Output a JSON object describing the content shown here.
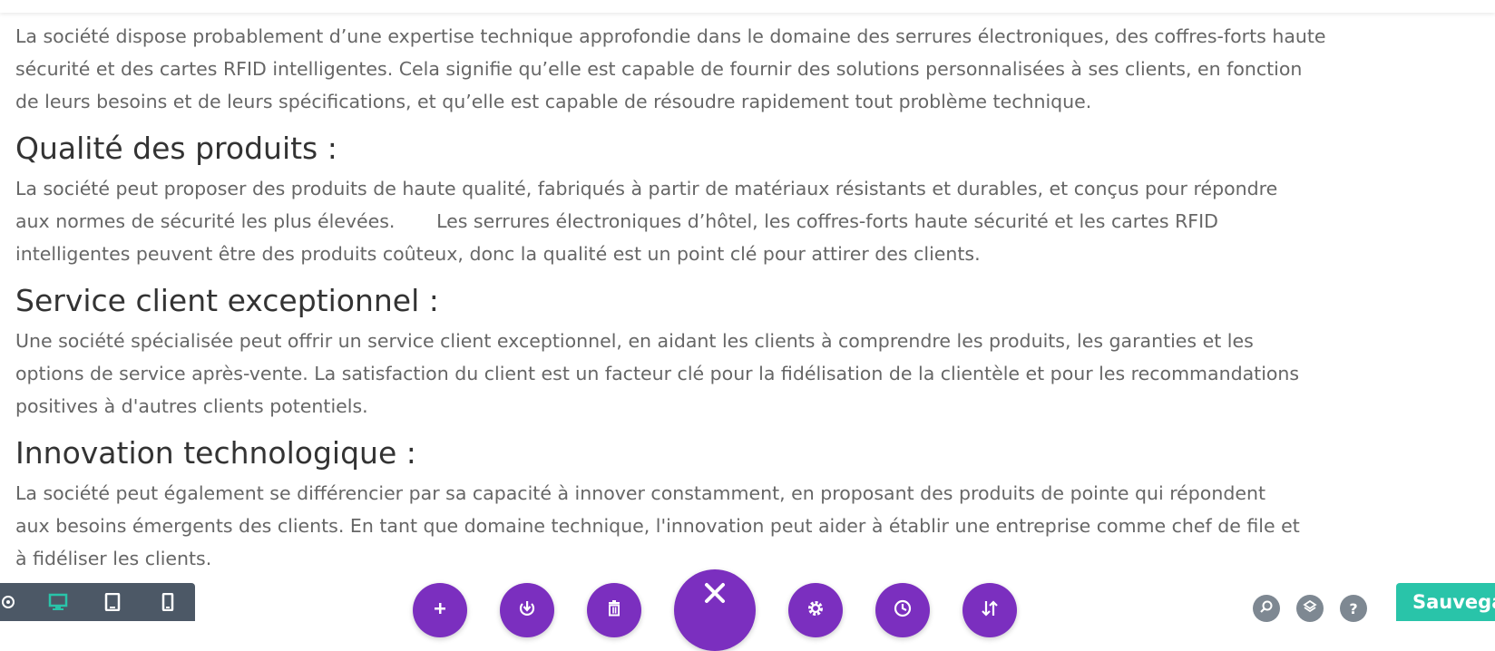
{
  "sections": [
    {
      "heading": "",
      "body": "La société dispose probablement d’une expertise technique approfondie dans le domaine des serrures électroniques, des coffres-forts haute sécurité et des cartes RFID intelligentes. Cela signifie qu’elle est capable de fournir des solutions personnalisées à ses clients, en fonction de leurs besoins et de leurs spécifications, et qu’elle est capable de résoudre rapidement tout problème technique."
    },
    {
      "heading": "Qualité des produits :",
      "body": "La société peut proposer des produits de haute qualité, fabriqués à partir de matériaux résistants et durables, et conçus pour répondre aux normes de sécurité les plus élevées.       Les serrures électroniques d’hôtel, les coffres-forts haute sécurité et les cartes RFID intelligentes peuvent être des produits coûteux, donc la qualité est un point clé pour attirer des clients."
    },
    {
      "heading": "Service client exceptionnel :",
      "body": "Une société spécialisée peut offrir un service client exceptionnel, en aidant les clients à comprendre les produits, les garanties et les options de service après-vente. La satisfaction du client est un facteur clé pour la fidélisation de la clientèle et pour les recommandations positives à d'autres clients potentiels."
    },
    {
      "heading": "Innovation technologique :",
      "body": "La société peut également se différencier par sa capacité à innover constamment, en proposant des produits de pointe qui répondent aux besoins émergents des clients. En tant que domaine technique, l'innovation peut aider à établir une entreprise comme chef de file et à fidéliser les clients."
    }
  ],
  "toolbar": {
    "save_label": "Sauvegar",
    "colors": {
      "purple": "#7b2fbf",
      "dark_bar": "#4c5866",
      "teal": "#29c4a9",
      "active_view": "#29c4a9",
      "grey_icon": "#7e8892"
    },
    "left_icons": [
      "zoom-icon",
      "desktop-icon",
      "tablet-icon",
      "phone-icon"
    ],
    "center_buttons": [
      "add-icon",
      "portability-icon",
      "trash-icon",
      "close-icon",
      "settings-icon",
      "history-icon",
      "sort-icon"
    ],
    "right_icons": [
      "search-icon",
      "layers-icon",
      "help-icon"
    ],
    "help_glyph": "?"
  }
}
